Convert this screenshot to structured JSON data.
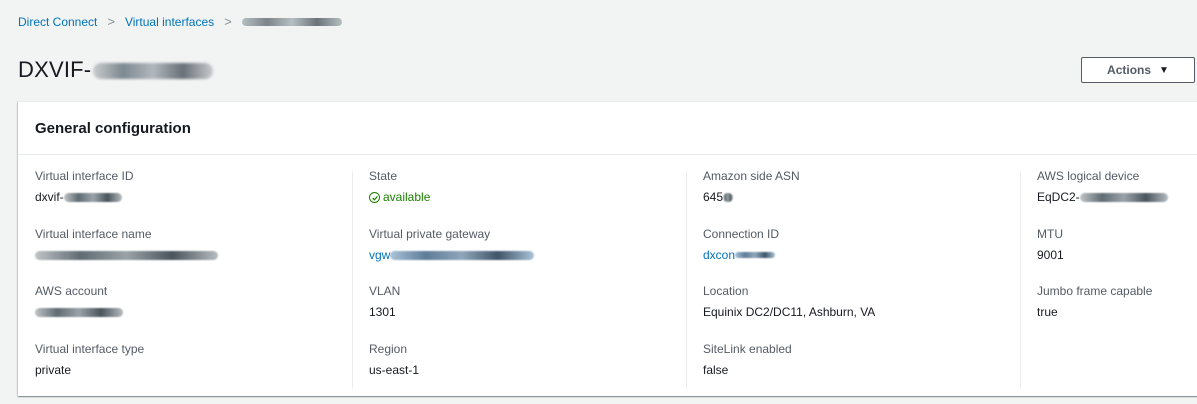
{
  "breadcrumb": {
    "items": [
      "Direct Connect",
      "Virtual interfaces"
    ],
    "separator": ">"
  },
  "header": {
    "title_prefix": "DXVIF-",
    "actions_label": "Actions",
    "actions_caret": "▼"
  },
  "panel": {
    "title": "General configuration",
    "columns": [
      [
        {
          "label": "Virtual interface ID",
          "value": "dxvif-"
        },
        {
          "label": "Virtual interface name",
          "value": ""
        },
        {
          "label": "AWS account",
          "value": ""
        },
        {
          "label": "Virtual interface type",
          "value": "private"
        }
      ],
      [
        {
          "label": "State",
          "value": "available",
          "status_color": "#1d8102",
          "icon": "check-circle-icon"
        },
        {
          "label": "Virtual private gateway",
          "value": "vgw"
        },
        {
          "label": "VLAN",
          "value": "1301"
        },
        {
          "label": "Region",
          "value": "us-east-1"
        }
      ],
      [
        {
          "label": "Amazon side ASN",
          "value": "645"
        },
        {
          "label": "Connection ID",
          "value": "dxcon"
        },
        {
          "label": "Location",
          "value": "Equinix DC2/DC11, Ashburn, VA"
        },
        {
          "label": "SiteLink enabled",
          "value": "false"
        }
      ],
      [
        {
          "label": "AWS logical device",
          "value": "EqDC2-"
        },
        {
          "label": "MTU",
          "value": "9001"
        },
        {
          "label": "Jumbo frame capable",
          "value": "true"
        }
      ]
    ]
  },
  "colors": {
    "link": "#0073bb",
    "success": "#1d8102",
    "background": "#f2f3f3"
  }
}
